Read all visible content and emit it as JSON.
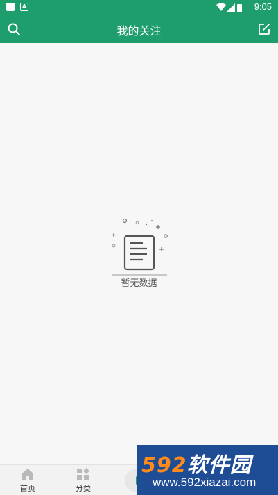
{
  "status_bar": {
    "time": "9:05"
  },
  "app_bar": {
    "title": "我的关注"
  },
  "empty_state": {
    "text": "暂无数据"
  },
  "bottom_nav": {
    "items": [
      {
        "label": "首页",
        "icon": "home-icon"
      },
      {
        "label": "分类",
        "icon": "grid-icon"
      }
    ]
  },
  "watermark": {
    "brand_num": "592",
    "brand_text": "软件园",
    "url": "www.592xiazai.com"
  },
  "colors": {
    "primary": "#1e9e6c",
    "watermark_bg": "#1e4d96",
    "watermark_accent": "#ff8a1a"
  }
}
